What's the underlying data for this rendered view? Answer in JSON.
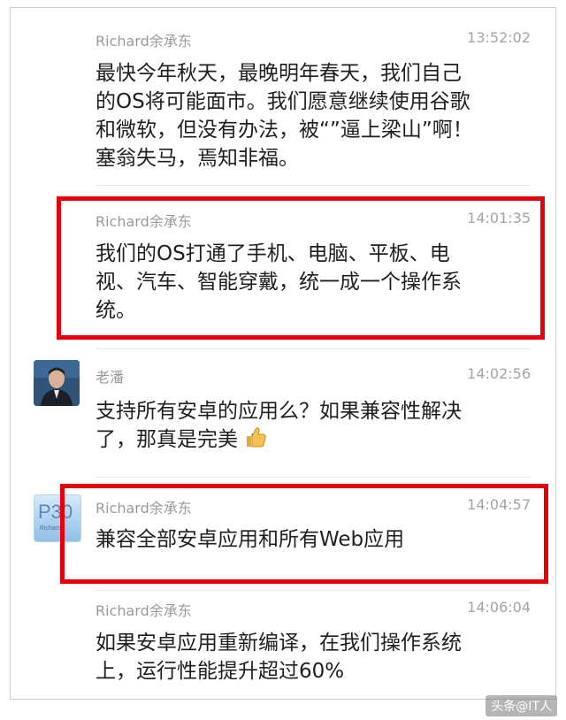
{
  "messages": [
    {
      "sender": "Richard余承东",
      "time": "13:52:02",
      "lines": [
        "最快今年秋天，最晚明年春天，我们自己",
        "的OS将可能面市。我们愿意继续使用谷歌",
        "和微软，但没有办法，被“”逼上梁山”啊！",
        "塞翁失马，焉知非福。"
      ]
    },
    {
      "sender": "Richard余承东",
      "time": "14:01:35",
      "lines": [
        "我们的OS打通了手机、电脑、平板、电",
        "视、汽车、智能穿戴，统一成一个操作系",
        "统。"
      ]
    },
    {
      "sender": "老潘",
      "time": "14:02:56",
      "lines": [
        "支持所有安卓的应用么？如果兼容性解决",
        "了，那真是完美"
      ],
      "emoji": "thumbs-up"
    },
    {
      "sender": "Richard余承东",
      "time": "14:04:57",
      "lines": [
        "兼容全部安卓应用和所有Web应用"
      ],
      "avatar_text": "P30",
      "avatar_sub": "Richard"
    },
    {
      "sender": "Richard余承东",
      "time": "14:06:04",
      "lines": [
        "如果安卓应用重新编译，在我们操作系统",
        "上，运行性能提升超过60%"
      ]
    }
  ],
  "watermark": "头条@IT人",
  "colors": {
    "highlight": "#e6000a",
    "sender": "#9a9a9a",
    "time": "#a4a4a4",
    "text": "#1f1f1f"
  }
}
